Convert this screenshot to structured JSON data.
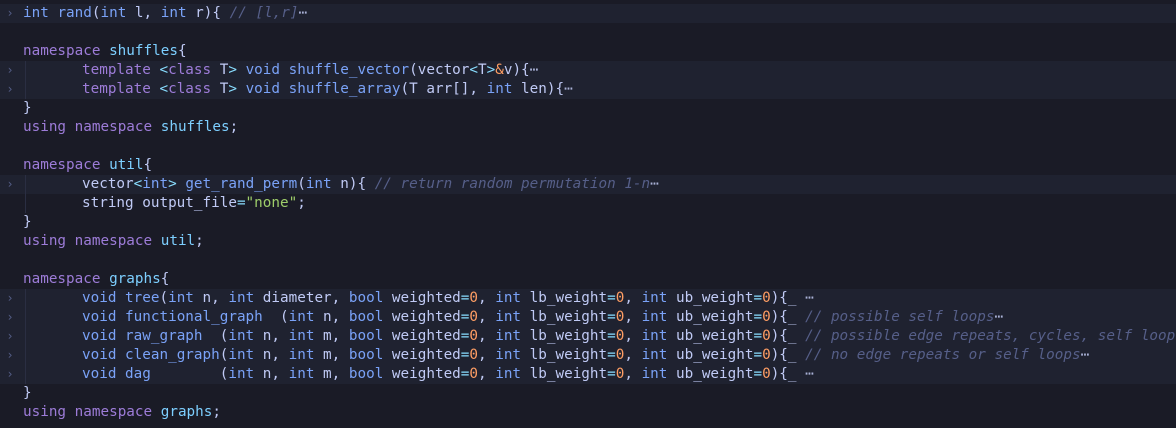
{
  "editor": {
    "lines": [
      {
        "folded": true,
        "indent": false,
        "tokens": [
          [
            "kw",
            "int"
          ],
          [
            "plain",
            " "
          ],
          [
            "fn",
            "rand"
          ],
          [
            "plain",
            "("
          ],
          [
            "kw",
            "int"
          ],
          [
            "plain",
            " l, "
          ],
          [
            "kw",
            "int"
          ],
          [
            "plain",
            " r){ "
          ],
          [
            "cm",
            "// [l,r]"
          ],
          [
            "ell",
            "⋯"
          ]
        ]
      },
      {
        "folded": false,
        "indent": false,
        "tokens": []
      },
      {
        "folded": false,
        "indent": false,
        "tokens": [
          [
            "kw2",
            "namespace"
          ],
          [
            "plain",
            " "
          ],
          [
            "ns",
            "shuffles"
          ],
          [
            "plain",
            "{"
          ]
        ]
      },
      {
        "folded": true,
        "indent": true,
        "tokens": [
          [
            "kw2",
            "template"
          ],
          [
            "plain",
            " "
          ],
          [
            "pun",
            "<"
          ],
          [
            "kw2",
            "class"
          ],
          [
            "plain",
            " T"
          ],
          [
            "pun",
            ">"
          ],
          [
            "plain",
            " "
          ],
          [
            "kw",
            "void"
          ],
          [
            "plain",
            " "
          ],
          [
            "fn",
            "shuffle_vector"
          ],
          [
            "plain",
            "(vector"
          ],
          [
            "pun",
            "<"
          ],
          [
            "plain",
            "T"
          ],
          [
            "pun",
            ">"
          ],
          [
            "num",
            "&"
          ],
          [
            "plain",
            "v){"
          ],
          [
            "ell",
            "⋯"
          ]
        ]
      },
      {
        "folded": true,
        "indent": true,
        "tokens": [
          [
            "kw2",
            "template"
          ],
          [
            "plain",
            " "
          ],
          [
            "pun",
            "<"
          ],
          [
            "kw2",
            "class"
          ],
          [
            "plain",
            " T"
          ],
          [
            "pun",
            ">"
          ],
          [
            "plain",
            " "
          ],
          [
            "kw",
            "void"
          ],
          [
            "plain",
            " "
          ],
          [
            "fn",
            "shuffle_array"
          ],
          [
            "plain",
            "(T arr[], "
          ],
          [
            "kw",
            "int"
          ],
          [
            "plain",
            " len){"
          ],
          [
            "ell",
            "⋯"
          ]
        ]
      },
      {
        "folded": false,
        "indent": false,
        "tokens": [
          [
            "plain",
            "}"
          ]
        ]
      },
      {
        "folded": false,
        "indent": false,
        "tokens": [
          [
            "kw2",
            "using"
          ],
          [
            "plain",
            " "
          ],
          [
            "kw2",
            "namespace"
          ],
          [
            "plain",
            " "
          ],
          [
            "ns",
            "shuffles"
          ],
          [
            "plain",
            ";"
          ]
        ]
      },
      {
        "folded": false,
        "indent": false,
        "tokens": []
      },
      {
        "folded": false,
        "indent": false,
        "tokens": [
          [
            "kw2",
            "namespace"
          ],
          [
            "plain",
            " "
          ],
          [
            "ns",
            "util"
          ],
          [
            "plain",
            "{"
          ]
        ]
      },
      {
        "folded": true,
        "indent": true,
        "tokens": [
          [
            "plain",
            "vector"
          ],
          [
            "pun",
            "<"
          ],
          [
            "kw",
            "int"
          ],
          [
            "pun",
            ">"
          ],
          [
            "plain",
            " "
          ],
          [
            "fn",
            "get_rand_perm"
          ],
          [
            "plain",
            "("
          ],
          [
            "kw",
            "int"
          ],
          [
            "plain",
            " n){ "
          ],
          [
            "cm",
            "// return random permutation 1-n"
          ],
          [
            "ell",
            "⋯"
          ]
        ]
      },
      {
        "folded": false,
        "indent": true,
        "tokens": [
          [
            "plain",
            "string output_file"
          ],
          [
            "pun",
            "="
          ],
          [
            "str",
            "\"none\""
          ],
          [
            "plain",
            ";"
          ]
        ]
      },
      {
        "folded": false,
        "indent": false,
        "tokens": [
          [
            "plain",
            "}"
          ]
        ]
      },
      {
        "folded": false,
        "indent": false,
        "tokens": [
          [
            "kw2",
            "using"
          ],
          [
            "plain",
            " "
          ],
          [
            "kw2",
            "namespace"
          ],
          [
            "plain",
            " "
          ],
          [
            "ns",
            "util"
          ],
          [
            "plain",
            ";"
          ]
        ]
      },
      {
        "folded": false,
        "indent": false,
        "tokens": []
      },
      {
        "folded": false,
        "indent": false,
        "tokens": [
          [
            "kw2",
            "namespace"
          ],
          [
            "plain",
            " "
          ],
          [
            "ns",
            "graphs"
          ],
          [
            "plain",
            "{"
          ]
        ]
      },
      {
        "folded": true,
        "indent": true,
        "tokens": [
          [
            "kw",
            "void"
          ],
          [
            "plain",
            " "
          ],
          [
            "fn",
            "tree"
          ],
          [
            "plain",
            "("
          ],
          [
            "kw",
            "int"
          ],
          [
            "plain",
            " n, "
          ],
          [
            "kw",
            "int"
          ],
          [
            "plain",
            " diameter, "
          ],
          [
            "kw",
            "bool"
          ],
          [
            "plain",
            " weighted"
          ],
          [
            "pun",
            "="
          ],
          [
            "num",
            "0"
          ],
          [
            "plain",
            ", "
          ],
          [
            "kw",
            "int"
          ],
          [
            "plain",
            " lb_weight"
          ],
          [
            "pun",
            "="
          ],
          [
            "num",
            "0"
          ],
          [
            "plain",
            ", "
          ],
          [
            "kw",
            "int"
          ],
          [
            "plain",
            " ub_weight"
          ],
          [
            "pun",
            "="
          ],
          [
            "num",
            "0"
          ],
          [
            "plain",
            "){"
          ],
          [
            "ell",
            "_ ⋯"
          ]
        ]
      },
      {
        "folded": true,
        "indent": true,
        "tokens": [
          [
            "kw",
            "void"
          ],
          [
            "plain",
            " "
          ],
          [
            "fn",
            "functional_graph"
          ],
          [
            "plain",
            "  ("
          ],
          [
            "kw",
            "int"
          ],
          [
            "plain",
            " n, "
          ],
          [
            "kw",
            "bool"
          ],
          [
            "plain",
            " weighted"
          ],
          [
            "pun",
            "="
          ],
          [
            "num",
            "0"
          ],
          [
            "plain",
            ", "
          ],
          [
            "kw",
            "int"
          ],
          [
            "plain",
            " lb_weight"
          ],
          [
            "pun",
            "="
          ],
          [
            "num",
            "0"
          ],
          [
            "plain",
            ", "
          ],
          [
            "kw",
            "int"
          ],
          [
            "plain",
            " ub_weight"
          ],
          [
            "pun",
            "="
          ],
          [
            "num",
            "0"
          ],
          [
            "plain",
            "){"
          ],
          [
            "ell",
            "_ "
          ],
          [
            "cm",
            "// possible self loops"
          ],
          [
            "ell",
            "⋯"
          ]
        ]
      },
      {
        "folded": true,
        "indent": true,
        "tokens": [
          [
            "kw",
            "void"
          ],
          [
            "plain",
            " "
          ],
          [
            "fn",
            "raw_graph"
          ],
          [
            "plain",
            "  ("
          ],
          [
            "kw",
            "int"
          ],
          [
            "plain",
            " n, "
          ],
          [
            "kw",
            "int"
          ],
          [
            "plain",
            " m, "
          ],
          [
            "kw",
            "bool"
          ],
          [
            "plain",
            " weighted"
          ],
          [
            "pun",
            "="
          ],
          [
            "num",
            "0"
          ],
          [
            "plain",
            ", "
          ],
          [
            "kw",
            "int"
          ],
          [
            "plain",
            " lb_weight"
          ],
          [
            "pun",
            "="
          ],
          [
            "num",
            "0"
          ],
          [
            "plain",
            ", "
          ],
          [
            "kw",
            "int"
          ],
          [
            "plain",
            " ub_weight"
          ],
          [
            "pun",
            "="
          ],
          [
            "num",
            "0"
          ],
          [
            "plain",
            "){"
          ],
          [
            "ell",
            "_ "
          ],
          [
            "cm",
            "// possible edge repeats, cycles, self loops"
          ],
          [
            "ell",
            "⋯"
          ]
        ]
      },
      {
        "folded": true,
        "indent": true,
        "tokens": [
          [
            "kw",
            "void"
          ],
          [
            "plain",
            " "
          ],
          [
            "fn",
            "clean_graph"
          ],
          [
            "plain",
            "("
          ],
          [
            "kw",
            "int"
          ],
          [
            "plain",
            " n, "
          ],
          [
            "kw",
            "int"
          ],
          [
            "plain",
            " m, "
          ],
          [
            "kw",
            "bool"
          ],
          [
            "plain",
            " weighted"
          ],
          [
            "pun",
            "="
          ],
          [
            "num",
            "0"
          ],
          [
            "plain",
            ", "
          ],
          [
            "kw",
            "int"
          ],
          [
            "plain",
            " lb_weight"
          ],
          [
            "pun",
            "="
          ],
          [
            "num",
            "0"
          ],
          [
            "plain",
            ", "
          ],
          [
            "kw",
            "int"
          ],
          [
            "plain",
            " ub_weight"
          ],
          [
            "pun",
            "="
          ],
          [
            "num",
            "0"
          ],
          [
            "plain",
            "){"
          ],
          [
            "ell",
            "_ "
          ],
          [
            "cm",
            "// no edge repeats or self loops"
          ],
          [
            "ell",
            "⋯"
          ]
        ]
      },
      {
        "folded": true,
        "indent": true,
        "tokens": [
          [
            "kw",
            "void"
          ],
          [
            "plain",
            " "
          ],
          [
            "fn",
            "dag"
          ],
          [
            "plain",
            "        ("
          ],
          [
            "kw",
            "int"
          ],
          [
            "plain",
            " n, "
          ],
          [
            "kw",
            "int"
          ],
          [
            "plain",
            " m, "
          ],
          [
            "kw",
            "bool"
          ],
          [
            "plain",
            " weighted"
          ],
          [
            "pun",
            "="
          ],
          [
            "num",
            "0"
          ],
          [
            "plain",
            ", "
          ],
          [
            "kw",
            "int"
          ],
          [
            "plain",
            " lb_weight"
          ],
          [
            "pun",
            "="
          ],
          [
            "num",
            "0"
          ],
          [
            "plain",
            ", "
          ],
          [
            "kw",
            "int"
          ],
          [
            "plain",
            " ub_weight"
          ],
          [
            "pun",
            "="
          ],
          [
            "num",
            "0"
          ],
          [
            "plain",
            "){"
          ],
          [
            "ell",
            "_ ⋯"
          ]
        ]
      },
      {
        "folded": false,
        "indent": false,
        "tokens": [
          [
            "plain",
            "}"
          ]
        ]
      },
      {
        "folded": false,
        "indent": false,
        "tokens": [
          [
            "kw2",
            "using"
          ],
          [
            "plain",
            " "
          ],
          [
            "kw2",
            "namespace"
          ],
          [
            "plain",
            " "
          ],
          [
            "ns",
            "graphs"
          ],
          [
            "plain",
            ";"
          ]
        ]
      }
    ],
    "fold_glyph": "›"
  }
}
